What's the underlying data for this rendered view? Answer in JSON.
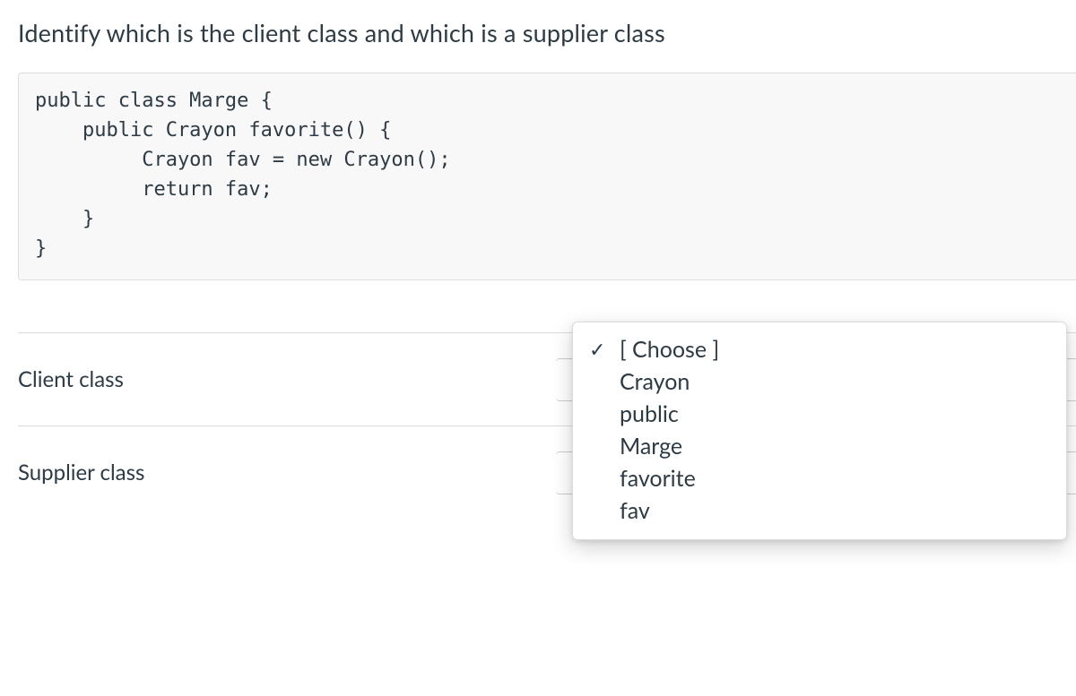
{
  "question": {
    "title": "Identify which is the client class and which is a supplier class",
    "code": "public class Marge {\n    public Crayon favorite() {\n         Crayon fav = new Crayon();\n         return fav;\n    }\n}"
  },
  "rows": [
    {
      "label": "Client class"
    },
    {
      "label": "Supplier class"
    }
  ],
  "dropdown": {
    "selected": "[ Choose ]",
    "options": [
      "[ Choose ]",
      "Crayon",
      "public",
      "Marge",
      "favorite",
      "fav"
    ]
  },
  "icons": {
    "check": "✓"
  }
}
